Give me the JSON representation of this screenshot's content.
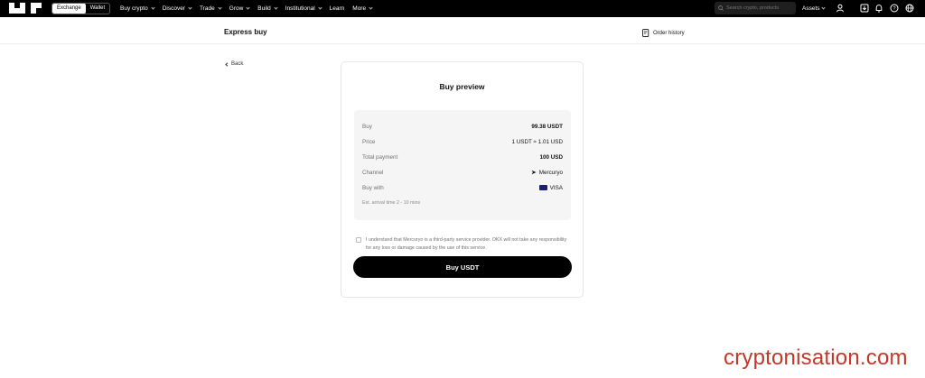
{
  "nav": {
    "segment": [
      "Exchange",
      "Wallet"
    ],
    "links": [
      {
        "label": "Buy crypto",
        "chevron": true
      },
      {
        "label": "Discover",
        "chevron": true
      },
      {
        "label": "Trade",
        "chevron": true
      },
      {
        "label": "Grow",
        "chevron": true
      },
      {
        "label": "Build",
        "chevron": true
      },
      {
        "label": "Institutional",
        "chevron": true
      },
      {
        "label": "Learn",
        "chevron": false
      },
      {
        "label": "More",
        "chevron": true
      }
    ],
    "search_placeholder": "Search crypto, products",
    "assets_label": "Assets",
    "icons": [
      "user-icon",
      "download-icon",
      "bell-icon",
      "help-icon",
      "globe-icon"
    ]
  },
  "page": {
    "title": "Express buy",
    "order_history": "Order history",
    "back": "Back"
  },
  "preview": {
    "title": "Buy preview",
    "rows": [
      {
        "key": "Buy",
        "value": "99.38 USDT",
        "bold": true
      },
      {
        "key": "Price",
        "value": "1 USDT ≈ 1.01 USD",
        "bold": false
      },
      {
        "key": "Total payment",
        "value": "100 USD",
        "bold": true
      },
      {
        "key": "Channel",
        "value": "Mercuryo",
        "bold": false,
        "icon": "mercuryo-icon"
      },
      {
        "key": "Buy with",
        "value": "VISA",
        "bold": false,
        "icon": "visa-card-icon"
      }
    ],
    "est": "Est. arrival time 2 - 10 mins",
    "agreement": "I understand that Mercuryo is a third-party service provider. OKX will not take any responsibility for any loss or damage caused by the use of this service.",
    "button": "Buy USDT"
  },
  "watermark": "cryptonisation.com",
  "colors": {
    "accent": "#000000",
    "watermark": "#c0392b",
    "visa": "#1a1f71"
  }
}
